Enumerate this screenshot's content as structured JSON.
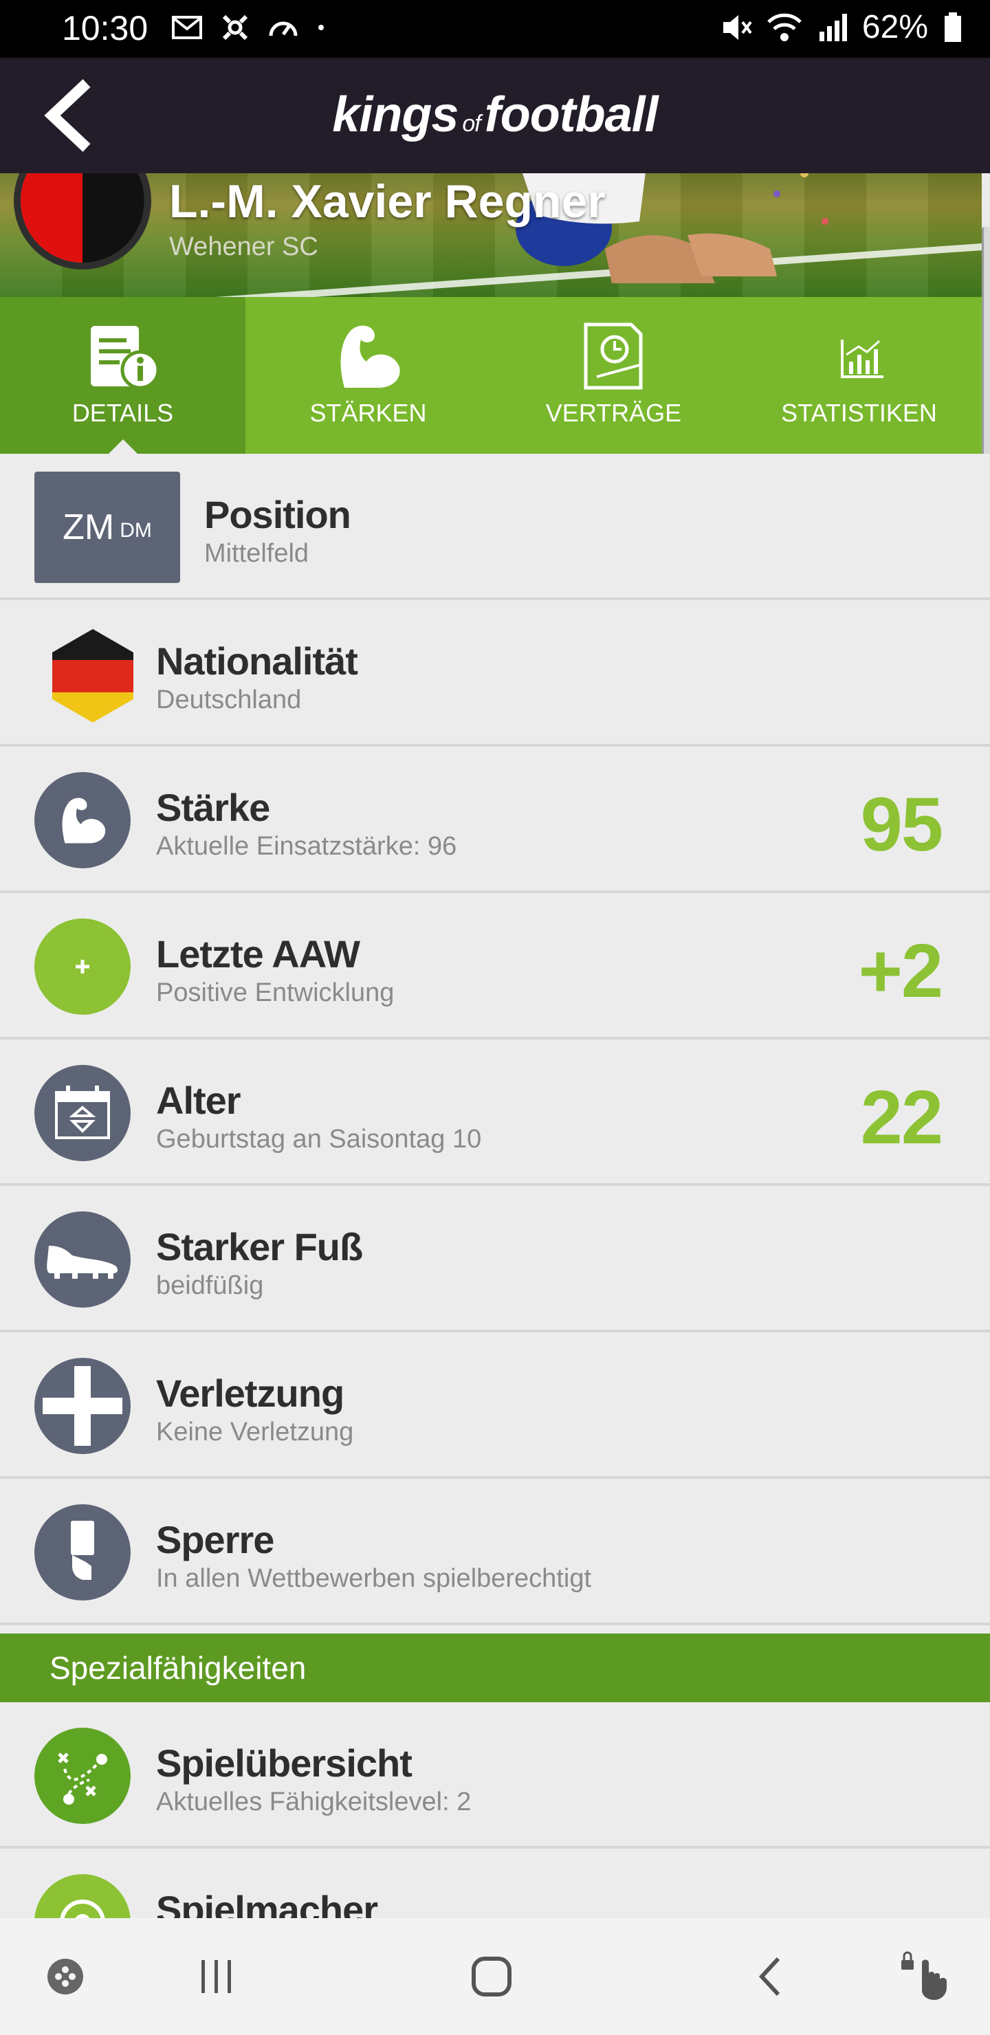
{
  "status_bar": {
    "time": "10:30",
    "battery": "62%",
    "icons": [
      "mail-icon",
      "settings-icon",
      "speedometer-icon",
      "dot-icon",
      "mute-icon",
      "wifi-icon",
      "signal-icon",
      "battery-icon"
    ]
  },
  "app_bar": {
    "logo_part1": "kings",
    "logo_part2": "of",
    "logo_part3": "football",
    "back_icon": "chevron-left-icon"
  },
  "player": {
    "name": "L.-M. Xavier Regner",
    "club": "Wehener SC",
    "club_colors": [
      "#e01010",
      "#111111"
    ]
  },
  "tabs": [
    {
      "label": "DETAILS",
      "icon": "document-info-icon",
      "active": true
    },
    {
      "label": "STÄRKEN",
      "icon": "bicep-icon",
      "active": false
    },
    {
      "label": "VERTRÄGE",
      "icon": "contract-clock-icon",
      "active": false
    },
    {
      "label": "STATISTIKEN",
      "icon": "chart-icon",
      "active": false
    }
  ],
  "position_row": {
    "badge_main": "ZM",
    "badge_sub": "DM",
    "title": "Position",
    "subtitle": "Mittelfeld"
  },
  "rows": [
    {
      "title": "Nationalität",
      "subtitle": "Deutschland",
      "icon": "germany-flag-icon",
      "value": ""
    },
    {
      "title": "Stärke",
      "subtitle": "Aktuelle Einsatzstärke: 96",
      "icon": "bicep-icon",
      "value": "95"
    },
    {
      "title": "Letzte AAW",
      "subtitle": "Positive Entwicklung",
      "icon": "plus-icon",
      "value": "+2"
    },
    {
      "title": "Alter",
      "subtitle": "Geburtstag an Saisontag 10",
      "icon": "calendar-icon",
      "value": "22"
    },
    {
      "title": "Starker Fuß",
      "subtitle": "beidfüßig",
      "icon": "football-boot-icon",
      "value": ""
    },
    {
      "title": "Verletzung",
      "subtitle": "Keine Verletzung",
      "icon": "medical-cross-icon",
      "value": ""
    },
    {
      "title": "Sperre",
      "subtitle": "In allen Wettbewerben spielberechtigt",
      "icon": "card-hand-icon",
      "value": ""
    }
  ],
  "special_section": {
    "header": "Spezialfähigkeiten",
    "rows": [
      {
        "title": "Spielübersicht",
        "subtitle": "Aktuelles Fähigkeitslevel: 2",
        "icon": "tactics-icon"
      },
      {
        "title": "Spielmacher",
        "subtitle": "",
        "icon": "playmaker-icon"
      }
    ]
  },
  "colors": {
    "accent_green": "#8cc234",
    "tab_green": "#79b82c",
    "dark_green": "#5d9a22",
    "app_bar": "#231d29",
    "icon_gray": "#5d6475"
  },
  "nav_bar": {
    "icons": [
      "game-icon",
      "recents-icon",
      "home-icon",
      "back-icon",
      "touch-lock-icon"
    ]
  }
}
